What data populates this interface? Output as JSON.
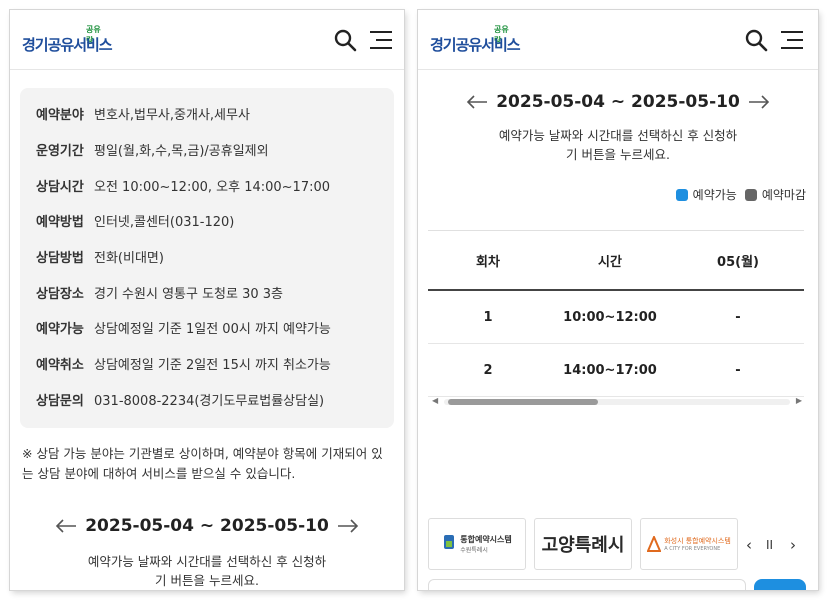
{
  "header": {
    "logo_small": "공유랑",
    "logo_main": "경기공유서비스",
    "search_icon": "search-icon",
    "menu_icon": "menu-icon"
  },
  "info": [
    {
      "label": "예약분야",
      "value": "변호사,법무사,중개사,세무사"
    },
    {
      "label": "운영기간",
      "value": "평일(월,화,수,목,금)/공휴일제외"
    },
    {
      "label": "상담시간",
      "value": "오전 10:00~12:00, 오후 14:00~17:00"
    },
    {
      "label": "예약방법",
      "value": "인터넷,콜센터(031-120)"
    },
    {
      "label": "상담방법",
      "value": "전화(비대면)"
    },
    {
      "label": "상담장소",
      "value": "경기 수원시 영통구 도청로 30  3층"
    },
    {
      "label": "예약가능",
      "value": "상담예정일 기준 1일전 00시 까지 예약가능"
    },
    {
      "label": "예약취소",
      "value": "상담예정일 기준 2일전 15시 까지 취소가능"
    },
    {
      "label": "상담문의",
      "value": "031-8008-2234(경기도무료법률상담실)"
    }
  ],
  "note": "※ 상담 가능 분야는 기관별로 상이하며, 예약분야 항목에 기재되어 있는 상담 분야에 대하여 서비스를 받으실 수 있습니다.",
  "calendar": {
    "range": "2025-05-04 ~ 2025-05-10",
    "guide_line1": "예약가능 날짜와 시간대를 선택하신 후 신청하",
    "guide_line2": "기 버튼을 누르세요."
  },
  "legend": [
    {
      "label": "예약가능",
      "color": "#1e8fe0"
    },
    {
      "label": "예약마감",
      "color": "#666666"
    }
  ],
  "table": {
    "headers": [
      "회차",
      "시간",
      "05(월)"
    ],
    "rows": [
      {
        "round": "1",
        "time": "10:00~12:00",
        "value": "-"
      },
      {
        "round": "2",
        "time": "14:00~17:00",
        "value": "-"
      }
    ]
  },
  "banners": {
    "b1": "통합예약시스템",
    "b1_sub": "수원특례시",
    "b2": "고양특례시",
    "b3": "화성시 통합예약시스템",
    "b3_sub": "A CITY FOR EVERYONE"
  },
  "controls": {
    "prev": "‹",
    "pause": "II",
    "next": "›"
  },
  "colors": {
    "accent": "#1e8fe0",
    "logo_blue": "#1f4e9c",
    "logo_green": "#1a8f3a"
  }
}
